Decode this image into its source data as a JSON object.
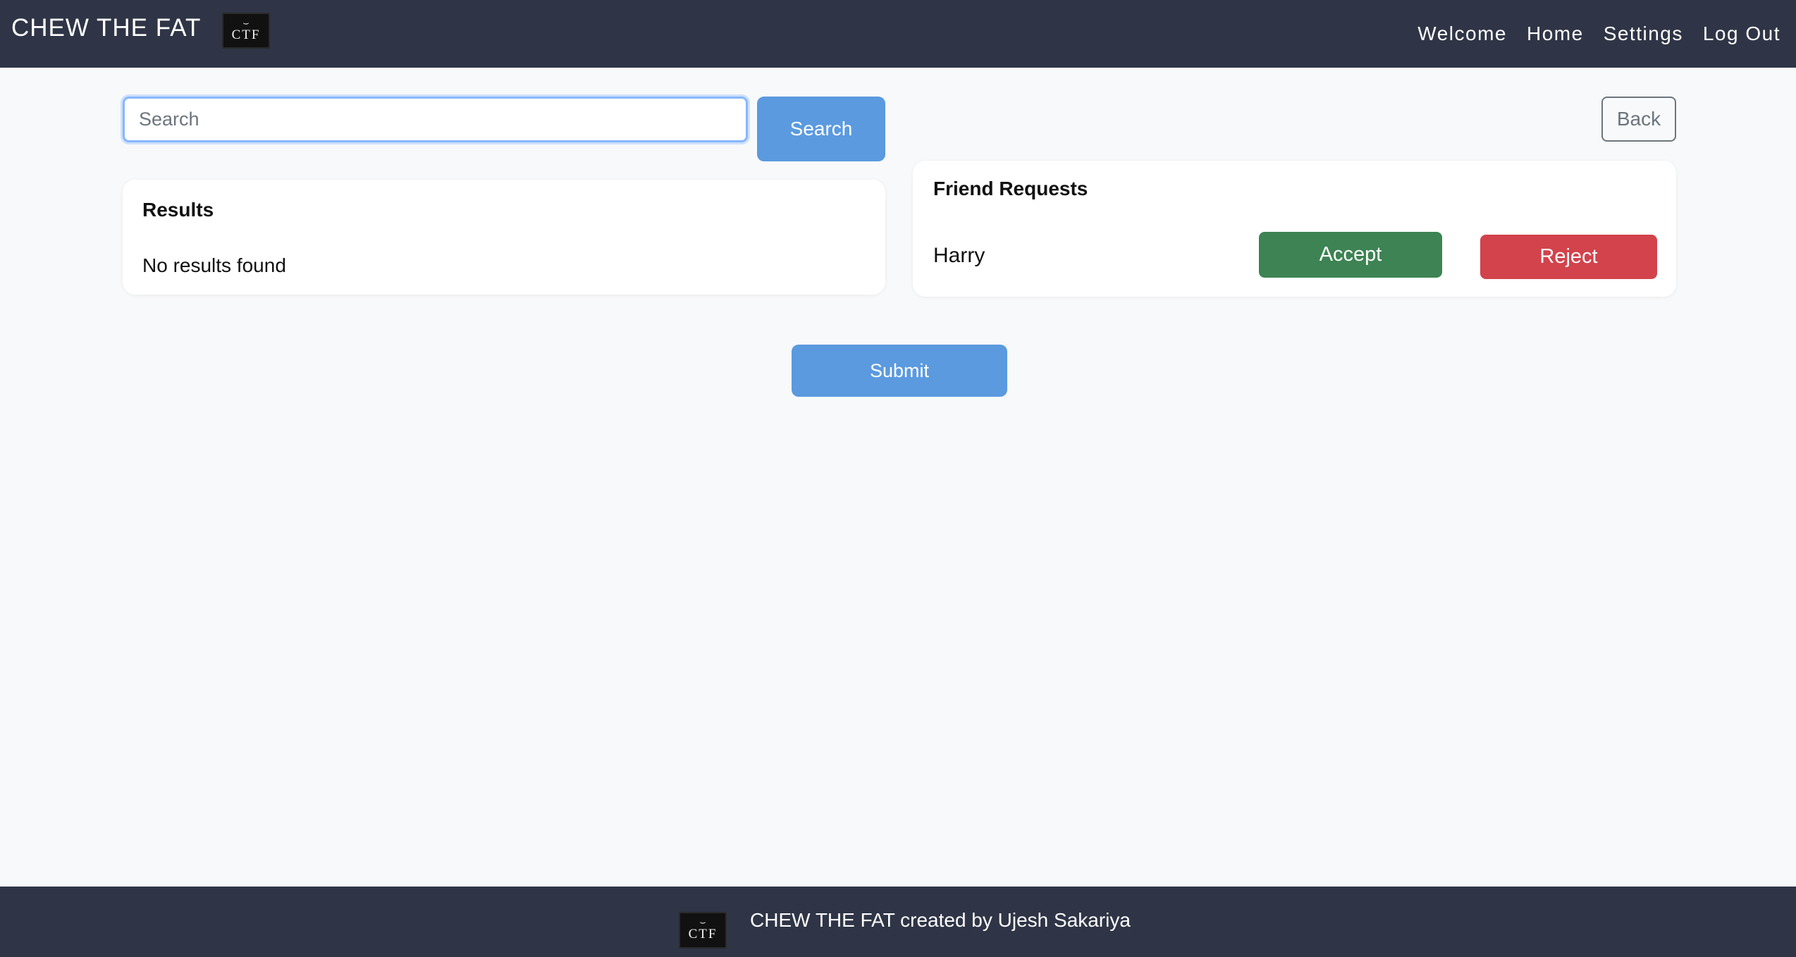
{
  "header": {
    "brand": "CHEW THE FAT",
    "logo_text": "CTF",
    "nav": [
      "Welcome",
      "Home",
      "Settings",
      "Log Out"
    ]
  },
  "search": {
    "placeholder": "Search",
    "value": "",
    "button_label": "Search"
  },
  "back_label": "Back",
  "results": {
    "title": "Results",
    "empty_text": "No results found"
  },
  "friend_requests": {
    "title": "Friend Requests",
    "items": [
      {
        "name": "Harry",
        "accept_label": "Accept",
        "reject_label": "Reject"
      }
    ]
  },
  "submit_label": "Submit",
  "footer": {
    "logo_text": "CTF",
    "text": "CHEW THE FAT created by Ujesh Sakariya"
  },
  "colors": {
    "navbar": "#2f3546",
    "primary": "#5b9adf",
    "accept": "#3d8353",
    "reject": "#d2434c",
    "background": "#f8f9fa"
  },
  "icons": {
    "logo": "ctf-logo"
  }
}
